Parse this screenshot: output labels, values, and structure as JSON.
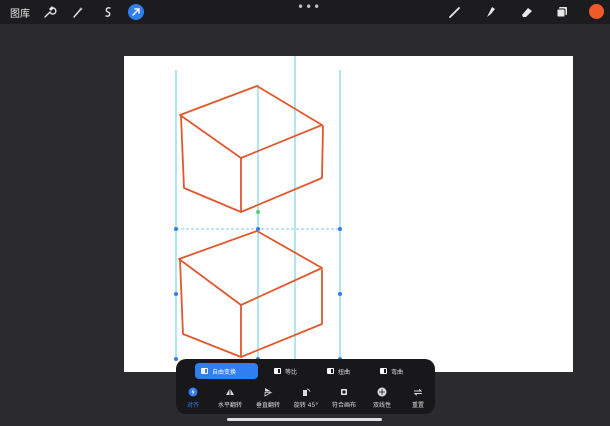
{
  "topbar": {
    "gallery_label": "图库",
    "tools_left": [
      {
        "icon": "wrench-icon"
      },
      {
        "icon": "magic-wand-icon"
      },
      {
        "icon": "selection-icon"
      },
      {
        "icon": "transform-arrow-icon",
        "active": true
      }
    ],
    "tools_right": [
      {
        "icon": "brush-icon"
      },
      {
        "icon": "smudge-icon"
      },
      {
        "icon": "eraser-icon"
      },
      {
        "icon": "layers-icon"
      }
    ],
    "color": "#f15a2b",
    "more_label": "•••"
  },
  "canvas": {
    "background": "#ffffff",
    "stroke_color": "#e0582e",
    "guide_color": "#3ec1d3"
  },
  "transform_panel": {
    "modes": [
      {
        "label": "自由变换",
        "active": true
      },
      {
        "label": "等比",
        "active": false
      },
      {
        "label": "扭曲",
        "active": false
      },
      {
        "label": "弯曲",
        "active": false
      }
    ],
    "actions": [
      {
        "label": "对齐",
        "active": true,
        "icon": "magnet-icon"
      },
      {
        "label": "水平翻转",
        "active": false,
        "icon": "flip-horizontal-icon"
      },
      {
        "label": "垂直翻转",
        "active": false,
        "icon": "flip-vertical-icon"
      },
      {
        "label": "旋转 45°",
        "active": false,
        "icon": "rotate-icon"
      },
      {
        "label": "符合画布",
        "active": false,
        "icon": "fit-canvas-icon"
      },
      {
        "label": "双线性",
        "active": false,
        "icon": "interpolation-icon"
      },
      {
        "label": "重置",
        "active": false,
        "icon": "reset-icon"
      }
    ],
    "accent": "#2f7ef2"
  }
}
